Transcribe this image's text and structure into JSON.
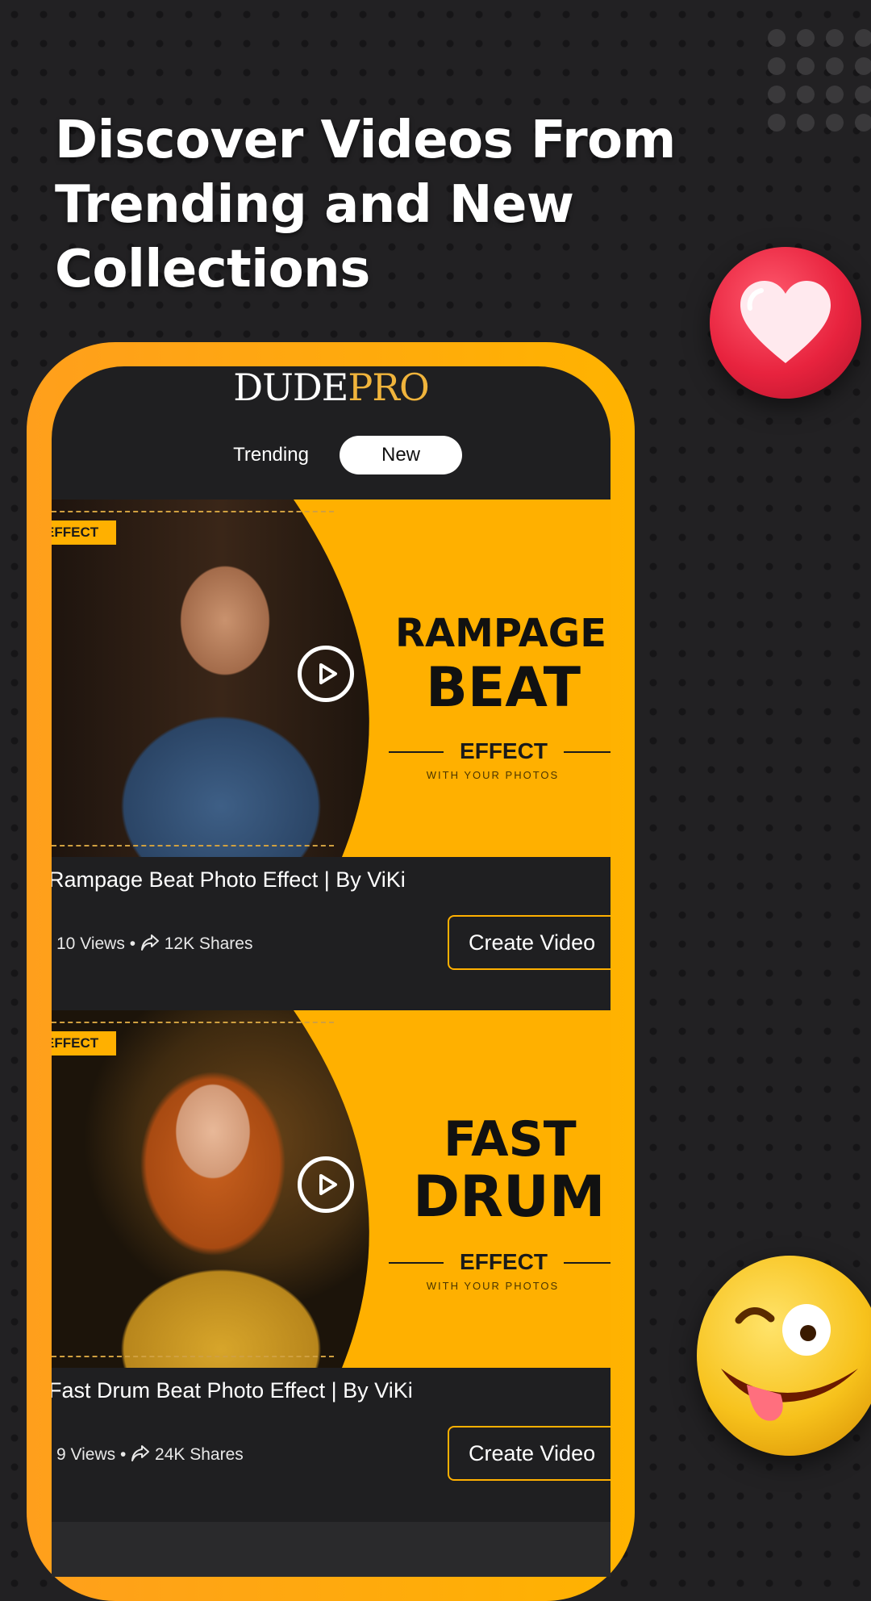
{
  "headline": "Discover Videos From Trending and New Collections",
  "logo": {
    "part1": "DUDE",
    "part2": "PRO"
  },
  "tabs": {
    "trending": "Trending",
    "new": "New",
    "selected": "New"
  },
  "colors": {
    "accent": "#ffb000",
    "background": "#222123",
    "screen": "#1f1f21",
    "logo_pro": "#f0b43c"
  },
  "cards": [
    {
      "tag": "EFFECT",
      "title_line1": "RAMPAGE",
      "title_line2": "BEAT",
      "effect_label": "EFFECT",
      "effect_sub": "WITH YOUR PHOTOS",
      "caption": "Rampage Beat Photo Effect | By ViKi",
      "views": "10 Views",
      "shares": "12K Shares",
      "button": "Create Video"
    },
    {
      "tag": "EFFECT",
      "title_line1": "FAST",
      "title_line2": "DRUM",
      "effect_label": "EFFECT",
      "effect_sub": "WITH YOUR PHOTOS",
      "caption": "Fast Drum Beat Photo Effect | By ViKi",
      "views": "9 Views",
      "shares": "24K Shares",
      "button": "Create Video"
    }
  ],
  "icons": [
    "heart-icon",
    "wink-emoji-icon",
    "play-icon",
    "share-icon"
  ]
}
